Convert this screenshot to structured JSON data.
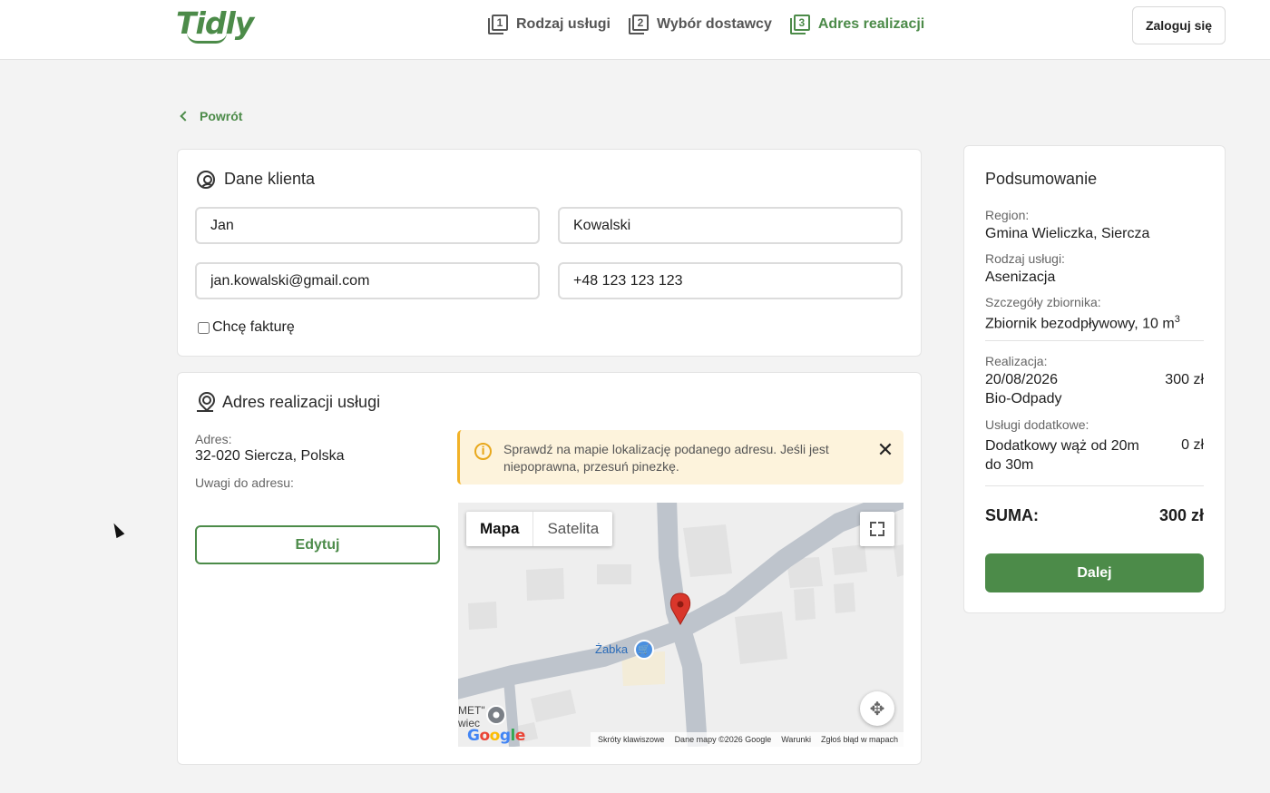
{
  "header": {
    "logo": "Tidly",
    "steps": [
      {
        "number": "1",
        "label": "Rodzaj usługi"
      },
      {
        "number": "2",
        "label": "Wybór dostawcy"
      },
      {
        "number": "3",
        "label": "Adres realizacji"
      }
    ],
    "login_label": "Zaloguj się",
    "accent_color": "#4c8b49"
  },
  "back_label": "Powrót",
  "client": {
    "title": "Dane klienta",
    "first_name": "Jan",
    "last_name": "Kowalski",
    "email": "jan.kowalski@gmail.com",
    "phone": "+48 123 123 123",
    "invoice_label": "Chcę fakturę",
    "invoice_checked": false
  },
  "address": {
    "title": "Adres realizacji usługi",
    "address_label": "Adres:",
    "address_value": "32-020 Siercza, Polska",
    "notes_label": "Uwagi do adresu:",
    "edit_label": "Edytuj",
    "alert_text": "Sprawdź na mapie lokalizację podanego adresu. Jeśli jest niepoprawna, przesuń pinezkę.",
    "alert_icon": "i",
    "close_glyph": "✕"
  },
  "map": {
    "type_map": "Mapa",
    "type_satellite": "Satelita",
    "poi_label": "Żabka",
    "edge_text_1": "MET\"",
    "edge_text_2": "wiec",
    "google": "Google",
    "footer": [
      "Skróty klawiszowe",
      "Dane mapy ©2026 Google",
      "Warunki",
      "Zgłoś błąd w mapach"
    ]
  },
  "summary": {
    "title": "Podsumowanie",
    "region_label": "Region:",
    "region_value": "Gmina Wieliczka, Siercza",
    "service_label": "Rodzaj usługi:",
    "service_value": "Asenizacja",
    "tank_label": "Szczegóły zbiornika:",
    "tank_value": "Zbiornik bezodpływowy, 10 m",
    "tank_unit_exp": "3",
    "realization_label": "Realizacja:",
    "realization_date": "20/08/2026",
    "realization_vendor": "Bio-Odpady",
    "realization_price": "300 zł",
    "extras_label": "Usługi dodatkowe:",
    "extra_name": "Dodatkowy wąż od 20m do 30m",
    "extra_price": "0 zł",
    "total_label": "SUMA:",
    "total_value": "300 zł",
    "next_label": "Dalej"
  }
}
